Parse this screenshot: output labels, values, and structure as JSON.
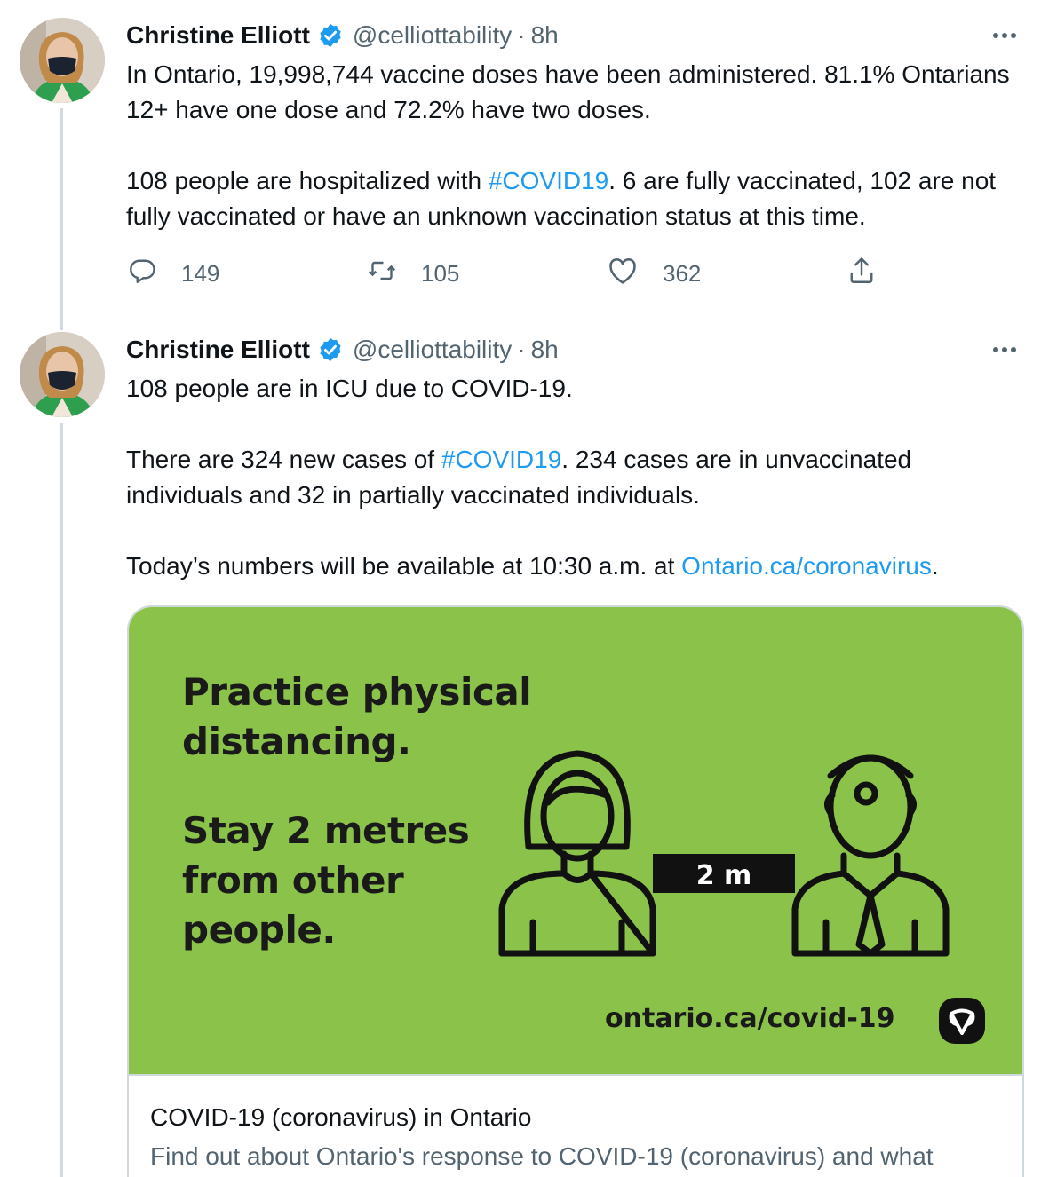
{
  "tweets": [
    {
      "name": "Christine Elliott",
      "handle": "@celliottability",
      "separator": "·",
      "time": "8h",
      "paragraphs": [
        {
          "before": "In Ontario, 19,998,744 vaccine doses have been administered. 81.1% Ontarians 12+ have one dose and 72.2% have two doses.",
          "link": "",
          "after": ""
        },
        {
          "before": "108 people are hospitalized with ",
          "link": "#COVID19",
          "after": ". 6 are fully vaccinated, 102 are not fully vaccinated or have an unknown vaccination status at this time."
        }
      ],
      "replies": "149",
      "retweets": "105",
      "likes": "362"
    },
    {
      "name": "Christine Elliott",
      "handle": "@celliottability",
      "separator": "·",
      "time": "8h",
      "paragraphs": [
        {
          "before": "108 people are in ICU due to COVID-19.",
          "link": "",
          "after": ""
        },
        {
          "before": "There are 324 new cases of ",
          "link": "#COVID19",
          "after": ". 234 cases are in unvaccinated individuals and 32 in partially vaccinated individuals."
        },
        {
          "before": "Today’s numbers will be available at 10:30 a.m. at ",
          "link": "Ontario.ca/coronavirus",
          "after": "."
        }
      ],
      "card": {
        "image_headline_1": "Practice physical",
        "image_headline_2": "distancing.",
        "image_subhead_1": "Stay 2 metres",
        "image_subhead_2": "from other",
        "image_subhead_3": "people.",
        "distance_label": "2 m",
        "image_url": "ontario.ca/covid-19",
        "title": "COVID-19 (coronavirus) in Ontario",
        "description": "Find out about Ontario's response to COVID-19 (coronavirus) and what"
      }
    }
  ],
  "colors": {
    "link": "#1d9bf0",
    "secondary_text": "#536471",
    "card_background": "#8bc34a",
    "thread_line": "#cfd9de"
  },
  "icons": [
    "verified-badge-icon",
    "more-icon",
    "reply-icon",
    "retweet-icon",
    "like-icon",
    "share-icon",
    "ontario-trillium-logo"
  ]
}
